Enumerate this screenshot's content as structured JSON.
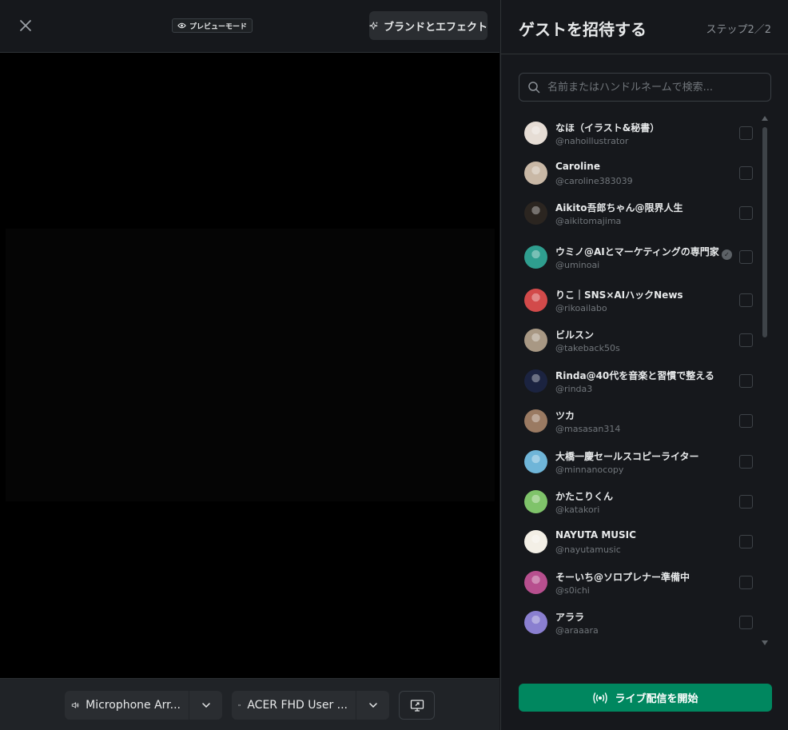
{
  "topbar": {
    "preview_label": "プレビューモード",
    "brand_button_label": "ブランドとエフェクト"
  },
  "devices": {
    "microphone_label": "Microphone Arr...",
    "camera_label": "ACER FHD User ..."
  },
  "panel": {
    "title": "ゲストを招待する",
    "step": "ステップ2／2",
    "search_placeholder": "名前またはハンドルネームで検索...",
    "go_live_label": "ライブ配信を開始"
  },
  "guests": [
    {
      "name": "なほ（イラスト&秘書）",
      "handle": "@nahoillustrator",
      "verified": false,
      "checked": false,
      "avatar_color": "#e6ddd5"
    },
    {
      "name": "Caroline",
      "handle": "@caroline383039",
      "verified": false,
      "checked": false,
      "avatar_color": "#c9b8a6"
    },
    {
      "name": "Aikito吾郎ちゃん@限界人生",
      "handle": "@aikitomajima",
      "verified": false,
      "checked": false,
      "avatar_color": "#2b2520"
    },
    {
      "name": "ウミノ@AIとマーケティングの専門家",
      "handle": "@uminoai",
      "verified": true,
      "checked": false,
      "avatar_color": "#2f9e8f"
    },
    {
      "name": "りこ｜SNS×AIハックNews",
      "handle": "@rikoailabo",
      "verified": false,
      "checked": false,
      "avatar_color": "#d24a4a"
    },
    {
      "name": "ビルスン",
      "handle": "@takeback50s",
      "verified": false,
      "checked": false,
      "avatar_color": "#a89884"
    },
    {
      "name": "Rinda@40代を音楽と習慣で整える",
      "handle": "@rinda3",
      "verified": false,
      "checked": false,
      "avatar_color": "#1b2340"
    },
    {
      "name": "ツカ",
      "handle": "@masasan314",
      "verified": false,
      "checked": false,
      "avatar_color": "#9a7a62"
    },
    {
      "name": "大橋一慶セールスコピーライター",
      "handle": "@minnanocopy",
      "verified": false,
      "checked": false,
      "avatar_color": "#6fb5d8"
    },
    {
      "name": "かたこりくん",
      "handle": "@katakori",
      "verified": false,
      "checked": false,
      "avatar_color": "#7fc36a"
    },
    {
      "name": "NAYUTA MUSIC",
      "handle": "@nayutamusic",
      "verified": false,
      "checked": false,
      "avatar_color": "#f3efe6"
    },
    {
      "name": "そーいち@ソロプレナー準備中",
      "handle": "@s0ichi",
      "verified": false,
      "checked": false,
      "avatar_color": "#b74f8e"
    },
    {
      "name": "アララ",
      "handle": "@araaara",
      "verified": false,
      "checked": false,
      "avatar_color": "#8a7fd0"
    }
  ]
}
